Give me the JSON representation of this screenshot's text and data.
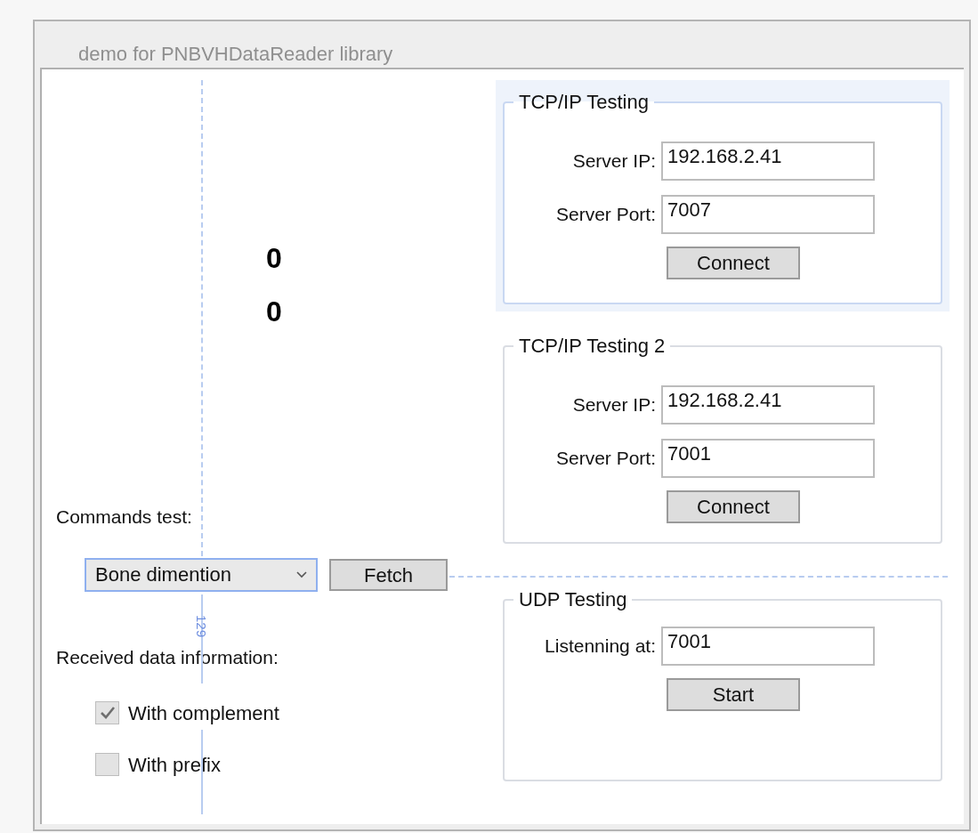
{
  "window": {
    "title": "demo for PNBVHDataReader library"
  },
  "counters": [
    "0",
    "0"
  ],
  "commands": {
    "label": "Commands test:",
    "combo_value": "Bone dimention",
    "button": "Fetch"
  },
  "received": {
    "label": "Received data information:",
    "options": [
      {
        "label": "With complement",
        "checked": true
      },
      {
        "label": "With prefix",
        "checked": false
      }
    ]
  },
  "groups": [
    {
      "title": "TCP/IP Testing",
      "highlighted": true,
      "fields": [
        {
          "label": "Server IP:",
          "value": "192.168.2.41"
        },
        {
          "label": "Server Port:",
          "value": "7007"
        }
      ],
      "button": "Connect"
    },
    {
      "title": "TCP/IP Testing 2",
      "highlighted": false,
      "fields": [
        {
          "label": "Server IP:",
          "value": "192.168.2.41"
        },
        {
          "label": "Server Port:",
          "value": "7001"
        }
      ],
      "button": "Connect"
    },
    {
      "title": "UDP Testing",
      "highlighted": false,
      "fields": [
        {
          "label": "Listenning at:",
          "value": "7001"
        }
      ],
      "button": "Start"
    }
  ],
  "designer": {
    "measurement": "129"
  }
}
